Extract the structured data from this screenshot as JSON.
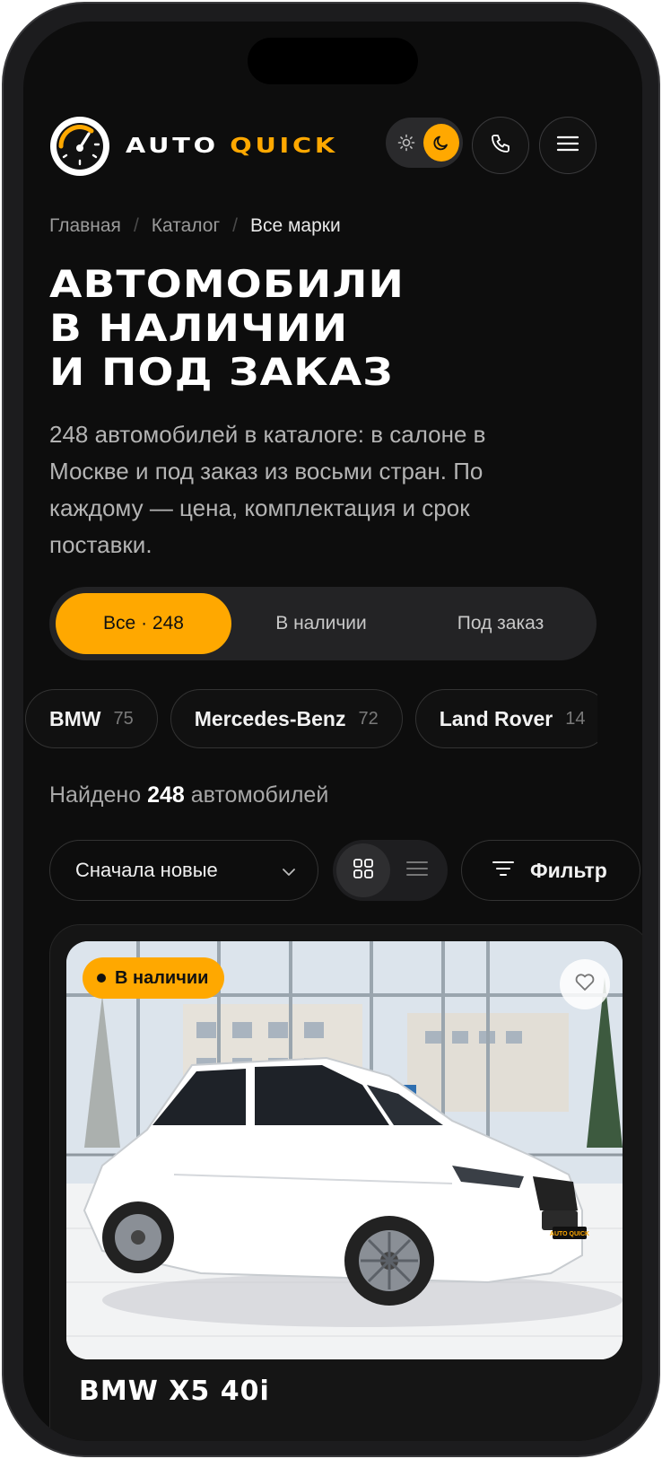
{
  "brand": {
    "word1": "AUTO",
    "word2": "QUICK",
    "accent": "#ffa800"
  },
  "header": {
    "theme_icons": [
      "sun-icon",
      "moon-icon"
    ],
    "phone_icon": "phone-icon",
    "menu_icon": "menu-icon"
  },
  "breadcrumb": {
    "items": [
      "Главная",
      "Каталог",
      "Все марки"
    ],
    "separator": "/"
  },
  "title": {
    "line1": "АВТОМОБИЛИ",
    "line2": "В НАЛИЧИИ",
    "line3": "И ПОД ЗАКАЗ"
  },
  "intro": "248 автомобилей в каталоге: в салоне в Москве и под заказ из восьми стран. По каждому — цена, комплектация и срок поставки.",
  "tabs": [
    {
      "label": "Все · 248",
      "active": true
    },
    {
      "label": "В наличии",
      "active": false
    },
    {
      "label": "Под заказ",
      "active": false
    }
  ],
  "brands": [
    {
      "name": "BMW",
      "count": "75"
    },
    {
      "name": "Mercedes-Benz",
      "count": "72"
    },
    {
      "name": "Land Rover",
      "count": "14"
    }
  ],
  "found": {
    "prefix": "Найдено",
    "count": "248",
    "suffix": "автомобилей"
  },
  "sort": {
    "label": "Сначала новые",
    "icon": "chevron-down-icon"
  },
  "view": {
    "active": "grid",
    "icons": [
      "grid-icon",
      "list-icon"
    ]
  },
  "filter": {
    "label": "Фильтр",
    "icon": "filter-icon"
  },
  "card": {
    "badge": "В наличии",
    "title": "BMW X5 40i",
    "photo_plate": "AUTO QUICK"
  }
}
